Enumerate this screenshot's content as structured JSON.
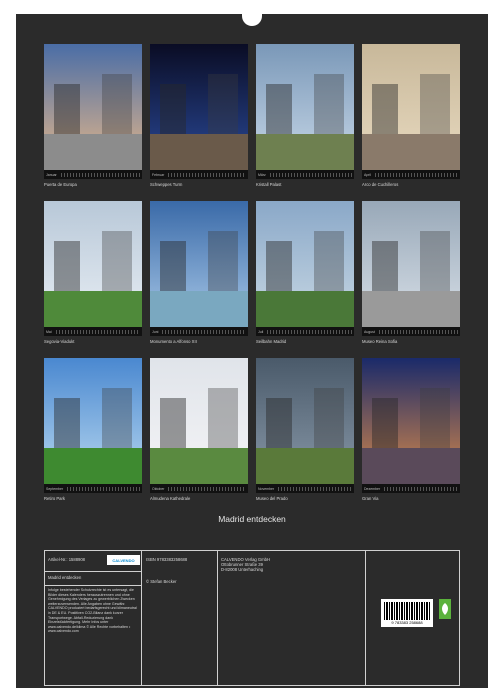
{
  "months": [
    {
      "label": "Januar",
      "caption": "Puerta de Europa",
      "sky": [
        "#4a6da6",
        "#e6b88a"
      ],
      "ground": "#8c8c8c"
    },
    {
      "label": "Februar",
      "caption": "Schweppes Turm",
      "sky": [
        "#0a0c24",
        "#2a4a9a"
      ],
      "ground": "#6a5a4a"
    },
    {
      "label": "März",
      "caption": "Kristall Palast",
      "sky": [
        "#7a98b8",
        "#c8d8e8"
      ],
      "ground": "#6e8050"
    },
    {
      "label": "April",
      "caption": "Arco de Cuchilleros",
      "sky": [
        "#c8b89a",
        "#e8dac0"
      ],
      "ground": "#8a7a6a"
    },
    {
      "label": "Mai",
      "caption": "Segovia-Viadukt",
      "sky": [
        "#b8c8d8",
        "#e8eef4"
      ],
      "ground": "#4f8a3a"
    },
    {
      "label": "Juni",
      "caption": "Monumento a Alfonso XII",
      "sky": [
        "#3a6aa8",
        "#a8c8e8"
      ],
      "ground": "#7aa8c0"
    },
    {
      "label": "Juli",
      "caption": "Seilbahn Madrid",
      "sky": [
        "#8aa8c8",
        "#c8d8e4"
      ],
      "ground": "#4a7838"
    },
    {
      "label": "August",
      "caption": "Museo Reina Sofia",
      "sky": [
        "#98a8b8",
        "#d8e0e8"
      ],
      "ground": "#9a9a9a"
    },
    {
      "label": "September",
      "caption": "Retiro Park",
      "sky": [
        "#4a88d0",
        "#b8d8f0"
      ],
      "ground": "#3e8a30"
    },
    {
      "label": "Oktober",
      "caption": "Almudena Kathedrale",
      "sky": [
        "#e0e4ea",
        "#f4f4f6"
      ],
      "ground": "#5a8a40"
    },
    {
      "label": "November",
      "caption": "Museo del Prado",
      "sky": [
        "#4a5a6a",
        "#8898a8"
      ],
      "ground": "#5a7a3a"
    },
    {
      "label": "Dezember",
      "caption": "Gran Via",
      "sky": [
        "#1a2a6a",
        "#d88a4a"
      ],
      "ground": "#5a4a5a"
    }
  ],
  "calendar_title": "Madrid entdecken",
  "info": {
    "article_no": "Artikel-Nr.:  1588908",
    "product": "Madrid entdecken",
    "legal": "Infolge bestehender Schutzrechte ist es untersagt, die Bilder dieses Kalenders herauszutrennen und ohne Genehmigung des Verlages zu gewerblichen Zwecken weiterzuverwenden. Alle Angaben ohne Gewähr. CALVENDO produziert bedarfsgerecht und klimaneutral in DE & EU. Postitiven CO2-Bilanz dank kurzer Transportwege. Abfall-Reduzierung dank Einzelstückfertigung. Mehr Infos unter www.calvendo.de/klima © Alle Rechte vorbehalten • www.calvendo.com",
    "logo": "CALVENDO",
    "isbn": "ISBN 9783383258688",
    "copyright": "© Stefan Becker",
    "publisher_lines": [
      "CALVENDO Verlag GmbH",
      "Ottobrunner Straße 39",
      "D-82008 Unterhaching"
    ],
    "barcode_number": "9 783383 258688"
  }
}
